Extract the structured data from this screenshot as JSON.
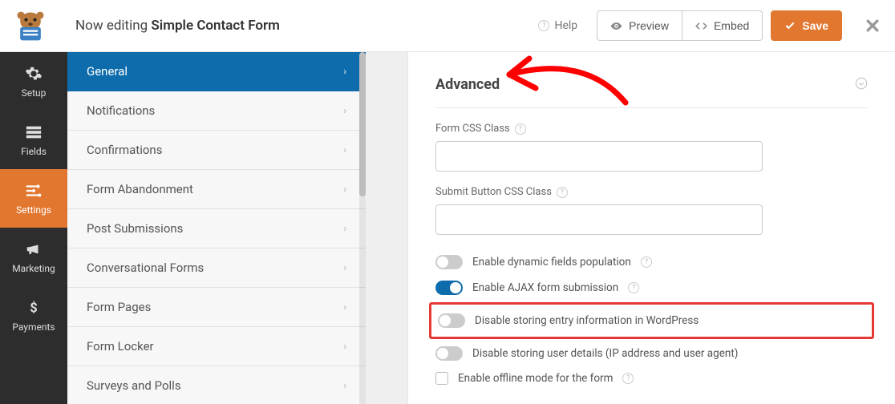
{
  "topbar": {
    "title_prefix": "Now editing ",
    "title_bold": "Simple Contact Form",
    "help": "Help",
    "preview": "Preview",
    "embed": "Embed",
    "save": "Save"
  },
  "vnav": {
    "items": [
      {
        "label": "Setup",
        "icon": "gear"
      },
      {
        "label": "Fields",
        "icon": "list"
      },
      {
        "label": "Settings",
        "icon": "sliders",
        "active": true
      },
      {
        "label": "Marketing",
        "icon": "megaphone"
      },
      {
        "label": "Payments",
        "icon": "dollar"
      }
    ]
  },
  "subnav": {
    "items": [
      {
        "label": "General",
        "active": true
      },
      {
        "label": "Notifications"
      },
      {
        "label": "Confirmations"
      },
      {
        "label": "Form Abandonment"
      },
      {
        "label": "Post Submissions"
      },
      {
        "label": "Conversational Forms"
      },
      {
        "label": "Form Pages"
      },
      {
        "label": "Form Locker"
      },
      {
        "label": "Surveys and Polls"
      }
    ]
  },
  "panel": {
    "title": "Advanced",
    "fields": {
      "form_css_label": "Form CSS Class",
      "form_css_value": "",
      "submit_css_label": "Submit Button CSS Class",
      "submit_css_value": ""
    },
    "toggles": {
      "dynamic": {
        "label": "Enable dynamic fields population",
        "on": false,
        "help": true
      },
      "ajax": {
        "label": "Enable AJAX form submission",
        "on": true,
        "help": true
      },
      "disable_entry": {
        "label": "Disable storing entry information in WordPress",
        "on": false,
        "highlight": true
      },
      "disable_user": {
        "label": "Disable storing user details (IP address and user agent)",
        "on": false
      },
      "offline": {
        "label": "Enable offline mode for the form",
        "checkbox": true,
        "help": true
      }
    }
  }
}
